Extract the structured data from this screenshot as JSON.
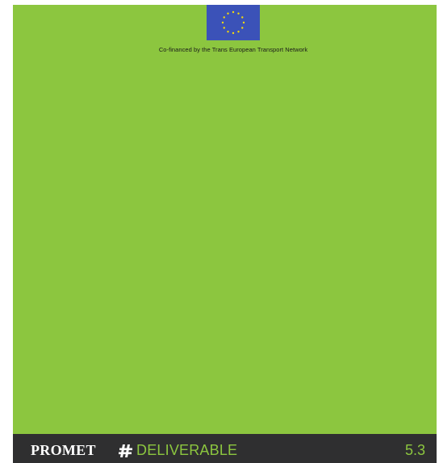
{
  "header": {
    "eu_flag_icon": "eu-flag-icon",
    "cofinanced_text": "Co-financed by the Trans European Transport Network"
  },
  "footer": {
    "brand": "PROMET",
    "brand_icon": "hash-icon",
    "label": "DELIVERABLE",
    "number": "5.3"
  },
  "colors": {
    "page_green": "#8cc63f",
    "footer_dark": "#2f2f30",
    "flag_blue": "#3b52b8",
    "star_yellow": "#f5d90a"
  }
}
